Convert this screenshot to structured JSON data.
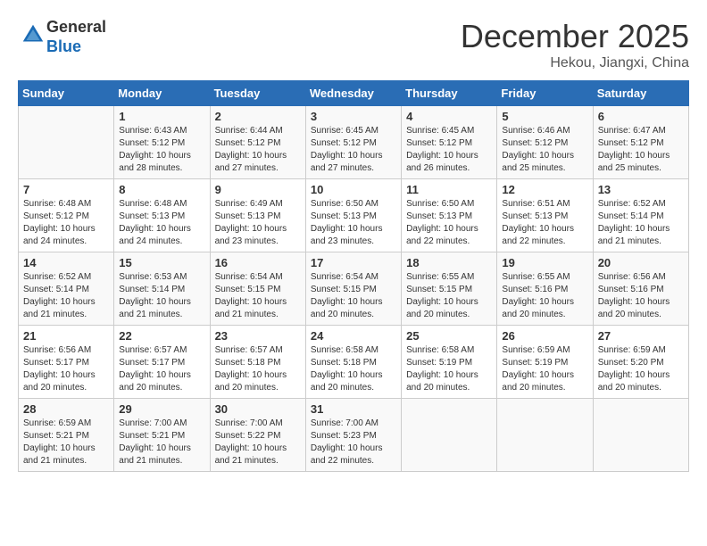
{
  "logo": {
    "general": "General",
    "blue": "Blue"
  },
  "title": "December 2025",
  "location": "Hekou, Jiangxi, China",
  "days_of_week": [
    "Sunday",
    "Monday",
    "Tuesday",
    "Wednesday",
    "Thursday",
    "Friday",
    "Saturday"
  ],
  "weeks": [
    [
      {
        "day": "",
        "sunrise": "",
        "sunset": "",
        "daylight": ""
      },
      {
        "day": "1",
        "sunrise": "Sunrise: 6:43 AM",
        "sunset": "Sunset: 5:12 PM",
        "daylight": "Daylight: 10 hours and 28 minutes."
      },
      {
        "day": "2",
        "sunrise": "Sunrise: 6:44 AM",
        "sunset": "Sunset: 5:12 PM",
        "daylight": "Daylight: 10 hours and 27 minutes."
      },
      {
        "day": "3",
        "sunrise": "Sunrise: 6:45 AM",
        "sunset": "Sunset: 5:12 PM",
        "daylight": "Daylight: 10 hours and 27 minutes."
      },
      {
        "day": "4",
        "sunrise": "Sunrise: 6:45 AM",
        "sunset": "Sunset: 5:12 PM",
        "daylight": "Daylight: 10 hours and 26 minutes."
      },
      {
        "day": "5",
        "sunrise": "Sunrise: 6:46 AM",
        "sunset": "Sunset: 5:12 PM",
        "daylight": "Daylight: 10 hours and 25 minutes."
      },
      {
        "day": "6",
        "sunrise": "Sunrise: 6:47 AM",
        "sunset": "Sunset: 5:12 PM",
        "daylight": "Daylight: 10 hours and 25 minutes."
      }
    ],
    [
      {
        "day": "7",
        "sunrise": "Sunrise: 6:48 AM",
        "sunset": "Sunset: 5:12 PM",
        "daylight": "Daylight: 10 hours and 24 minutes."
      },
      {
        "day": "8",
        "sunrise": "Sunrise: 6:48 AM",
        "sunset": "Sunset: 5:13 PM",
        "daylight": "Daylight: 10 hours and 24 minutes."
      },
      {
        "day": "9",
        "sunrise": "Sunrise: 6:49 AM",
        "sunset": "Sunset: 5:13 PM",
        "daylight": "Daylight: 10 hours and 23 minutes."
      },
      {
        "day": "10",
        "sunrise": "Sunrise: 6:50 AM",
        "sunset": "Sunset: 5:13 PM",
        "daylight": "Daylight: 10 hours and 23 minutes."
      },
      {
        "day": "11",
        "sunrise": "Sunrise: 6:50 AM",
        "sunset": "Sunset: 5:13 PM",
        "daylight": "Daylight: 10 hours and 22 minutes."
      },
      {
        "day": "12",
        "sunrise": "Sunrise: 6:51 AM",
        "sunset": "Sunset: 5:13 PM",
        "daylight": "Daylight: 10 hours and 22 minutes."
      },
      {
        "day": "13",
        "sunrise": "Sunrise: 6:52 AM",
        "sunset": "Sunset: 5:14 PM",
        "daylight": "Daylight: 10 hours and 21 minutes."
      }
    ],
    [
      {
        "day": "14",
        "sunrise": "Sunrise: 6:52 AM",
        "sunset": "Sunset: 5:14 PM",
        "daylight": "Daylight: 10 hours and 21 minutes."
      },
      {
        "day": "15",
        "sunrise": "Sunrise: 6:53 AM",
        "sunset": "Sunset: 5:14 PM",
        "daylight": "Daylight: 10 hours and 21 minutes."
      },
      {
        "day": "16",
        "sunrise": "Sunrise: 6:54 AM",
        "sunset": "Sunset: 5:15 PM",
        "daylight": "Daylight: 10 hours and 21 minutes."
      },
      {
        "day": "17",
        "sunrise": "Sunrise: 6:54 AM",
        "sunset": "Sunset: 5:15 PM",
        "daylight": "Daylight: 10 hours and 20 minutes."
      },
      {
        "day": "18",
        "sunrise": "Sunrise: 6:55 AM",
        "sunset": "Sunset: 5:15 PM",
        "daylight": "Daylight: 10 hours and 20 minutes."
      },
      {
        "day": "19",
        "sunrise": "Sunrise: 6:55 AM",
        "sunset": "Sunset: 5:16 PM",
        "daylight": "Daylight: 10 hours and 20 minutes."
      },
      {
        "day": "20",
        "sunrise": "Sunrise: 6:56 AM",
        "sunset": "Sunset: 5:16 PM",
        "daylight": "Daylight: 10 hours and 20 minutes."
      }
    ],
    [
      {
        "day": "21",
        "sunrise": "Sunrise: 6:56 AM",
        "sunset": "Sunset: 5:17 PM",
        "daylight": "Daylight: 10 hours and 20 minutes."
      },
      {
        "day": "22",
        "sunrise": "Sunrise: 6:57 AM",
        "sunset": "Sunset: 5:17 PM",
        "daylight": "Daylight: 10 hours and 20 minutes."
      },
      {
        "day": "23",
        "sunrise": "Sunrise: 6:57 AM",
        "sunset": "Sunset: 5:18 PM",
        "daylight": "Daylight: 10 hours and 20 minutes."
      },
      {
        "day": "24",
        "sunrise": "Sunrise: 6:58 AM",
        "sunset": "Sunset: 5:18 PM",
        "daylight": "Daylight: 10 hours and 20 minutes."
      },
      {
        "day": "25",
        "sunrise": "Sunrise: 6:58 AM",
        "sunset": "Sunset: 5:19 PM",
        "daylight": "Daylight: 10 hours and 20 minutes."
      },
      {
        "day": "26",
        "sunrise": "Sunrise: 6:59 AM",
        "sunset": "Sunset: 5:19 PM",
        "daylight": "Daylight: 10 hours and 20 minutes."
      },
      {
        "day": "27",
        "sunrise": "Sunrise: 6:59 AM",
        "sunset": "Sunset: 5:20 PM",
        "daylight": "Daylight: 10 hours and 20 minutes."
      }
    ],
    [
      {
        "day": "28",
        "sunrise": "Sunrise: 6:59 AM",
        "sunset": "Sunset: 5:21 PM",
        "daylight": "Daylight: 10 hours and 21 minutes."
      },
      {
        "day": "29",
        "sunrise": "Sunrise: 7:00 AM",
        "sunset": "Sunset: 5:21 PM",
        "daylight": "Daylight: 10 hours and 21 minutes."
      },
      {
        "day": "30",
        "sunrise": "Sunrise: 7:00 AM",
        "sunset": "Sunset: 5:22 PM",
        "daylight": "Daylight: 10 hours and 21 minutes."
      },
      {
        "day": "31",
        "sunrise": "Sunrise: 7:00 AM",
        "sunset": "Sunset: 5:23 PM",
        "daylight": "Daylight: 10 hours and 22 minutes."
      },
      {
        "day": "",
        "sunrise": "",
        "sunset": "",
        "daylight": ""
      },
      {
        "day": "",
        "sunrise": "",
        "sunset": "",
        "daylight": ""
      },
      {
        "day": "",
        "sunrise": "",
        "sunset": "",
        "daylight": ""
      }
    ]
  ]
}
